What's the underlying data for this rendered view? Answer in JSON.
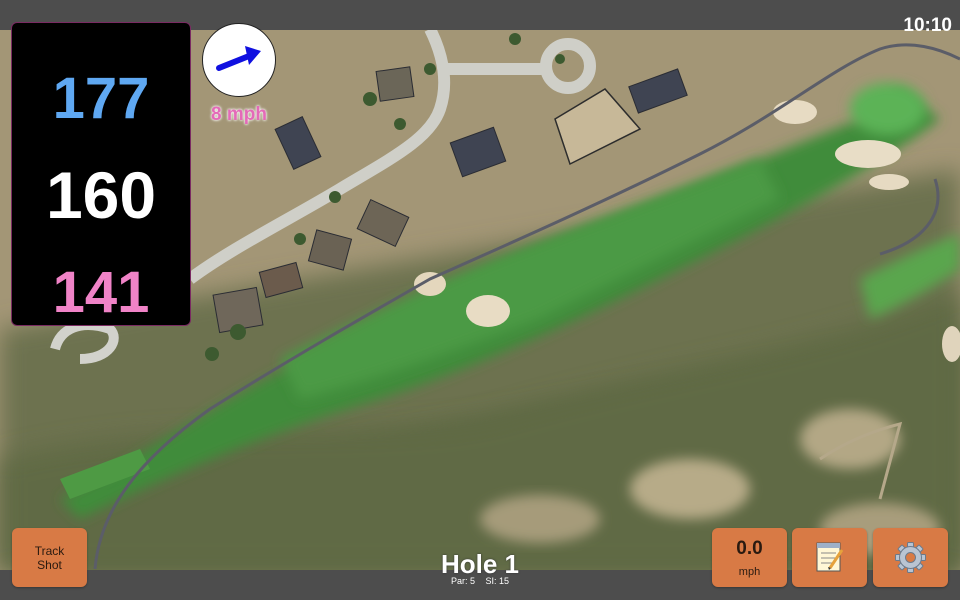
{
  "status_bar": {
    "time": "10:10"
  },
  "yardage": {
    "back": "177",
    "middle": "160",
    "front": "141"
  },
  "wind": {
    "speed_label": "8 mph",
    "direction_icon": "arrow-icon",
    "arrow_color": "#1010e0"
  },
  "hole": {
    "title": "Hole 1",
    "par": "Par: 5",
    "stroke_index": "SI: 15"
  },
  "buttons": {
    "track_shot_line1": "Track",
    "track_shot_line2": "Shot",
    "speed_value": "0.0",
    "speed_unit": "mph",
    "notes_icon": "notepad-icon",
    "settings_icon": "gear-icon"
  },
  "colors": {
    "button_bg": "#d87a45",
    "back_yardage": "#5fa8f2",
    "middle_yardage": "#ffffff",
    "front_yardage": "#f083c7",
    "wind_text": "#e46ab8"
  }
}
